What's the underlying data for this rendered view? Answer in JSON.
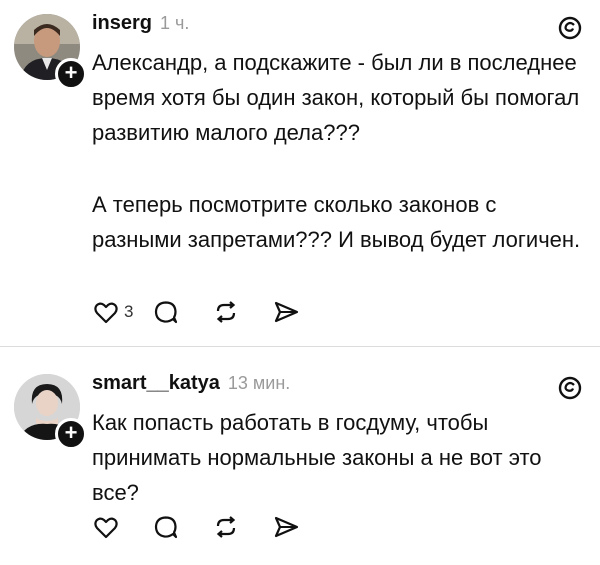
{
  "posts": [
    {
      "username": "inserg",
      "time": "1 ч.",
      "paragraphs": [
        "Александр, а подскажите - был ли в последнее время хотя бы один закон, который бы помогал развитию малого дела???",
        "А теперь посмотрите сколько законов с разными запретами??? И вывод будет логичен."
      ],
      "like_count": "3"
    },
    {
      "username": "smart__katya",
      "time": "13 мин.",
      "paragraphs": [
        "Как попасть работать в госдуму, чтобы принимать нормальные законы а не вот это все?"
      ],
      "like_count": ""
    }
  ],
  "icons": {
    "like": "heart-icon",
    "reply": "comment-icon",
    "repost": "repost-icon",
    "share": "send-icon",
    "app": "threads-icon",
    "follow": "plus-icon"
  }
}
